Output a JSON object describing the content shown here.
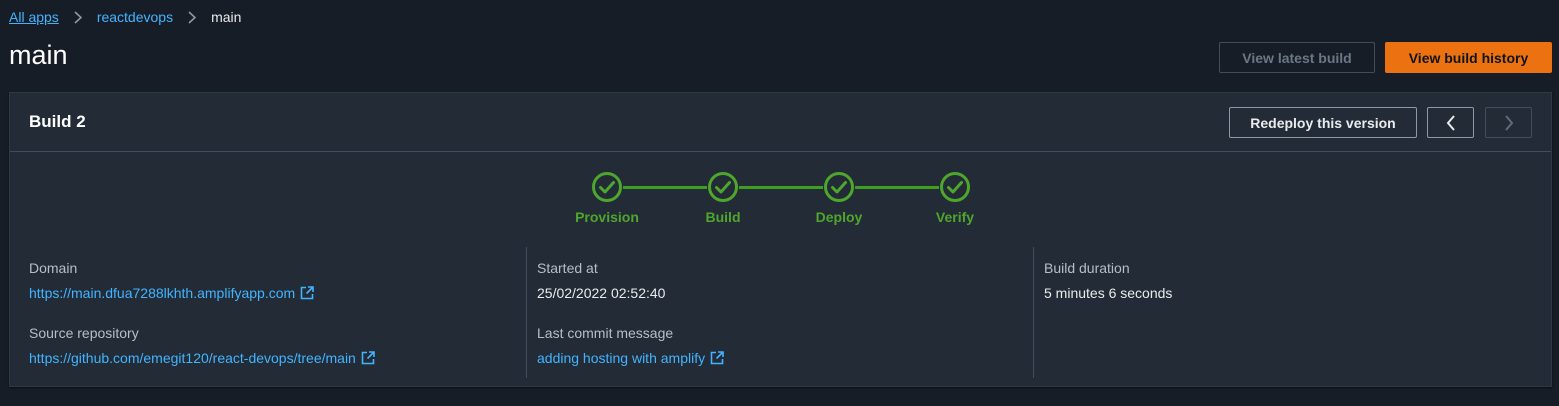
{
  "breadcrumb": {
    "items": [
      "All apps",
      "reactdevops"
    ],
    "current": "main"
  },
  "page": {
    "title": "main"
  },
  "header_actions": {
    "view_latest_build": "View latest build",
    "view_build_history": "View build history"
  },
  "build": {
    "title": "Build 2",
    "redeploy_label": "Redeploy this version",
    "prev_icon": "chevron-left-icon",
    "next_icon": "chevron-right-icon",
    "steps": [
      {
        "label": "Provision",
        "status": "succeeded",
        "icon": "check-circle-icon"
      },
      {
        "label": "Build",
        "status": "succeeded",
        "icon": "check-circle-icon"
      },
      {
        "label": "Deploy",
        "status": "succeeded",
        "icon": "check-circle-icon"
      },
      {
        "label": "Verify",
        "status": "succeeded",
        "icon": "check-circle-icon"
      }
    ],
    "domain_label": "Domain",
    "domain_value": "https://main.dfua7288lkhth.amplifyapp.com",
    "source_repository_label": "Source repository",
    "source_repository_value": "https://github.com/emegit120/react-devops/tree/main",
    "started_at_label": "Started at",
    "started_at_value": "25/02/2022 02:52:40",
    "last_commit_label": "Last commit message",
    "last_commit_value": "adding hosting with amplify",
    "build_duration_label": "Build duration",
    "build_duration_value": "5 minutes 6 seconds"
  },
  "colors": {
    "background": "#161d26",
    "panel": "#232b36",
    "accent": "#ec7211",
    "link": "#42b4ff",
    "success": "#4ea62c"
  }
}
